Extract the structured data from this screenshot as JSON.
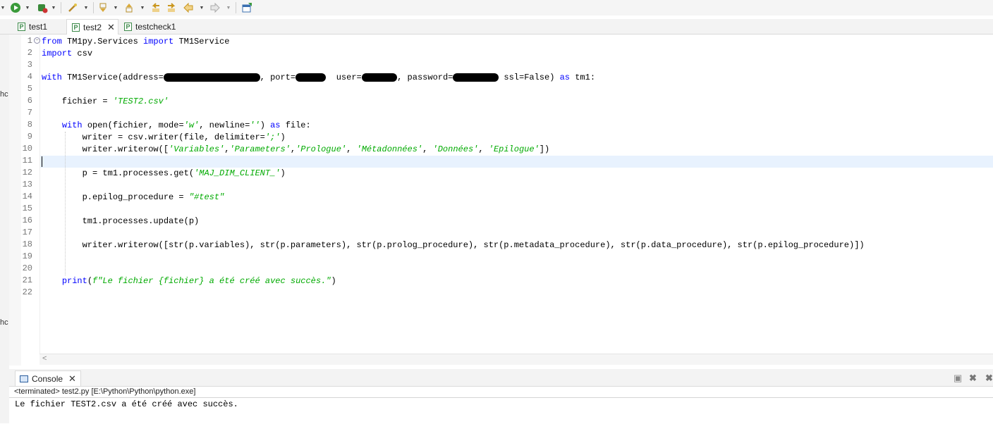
{
  "editor_tabs": [
    {
      "label": "test1"
    },
    {
      "label": "test2",
      "active": true,
      "closable": true
    },
    {
      "label": "testcheck1"
    }
  ],
  "left_panel_fragments": [
    "hc",
    "hc"
  ],
  "code_lines": [
    [
      {
        "t": "from",
        "c": "kw"
      },
      {
        "t": " TM1py.Services "
      },
      {
        "t": "import",
        "c": "kw"
      },
      {
        "t": " TM1Service"
      }
    ],
    [
      {
        "t": "import",
        "c": "kw"
      },
      {
        "t": " csv"
      }
    ],
    [],
    [
      {
        "t": "with",
        "c": "kw"
      },
      {
        "t": " TM1Service(address="
      },
      {
        "t": "                   ",
        "redact": true
      },
      {
        "t": ", port="
      },
      {
        "t": "      ",
        "redact": true
      },
      {
        "t": "  user="
      },
      {
        "t": "       ",
        "redact": true
      },
      {
        "t": ", password="
      },
      {
        "t": "         ",
        "redact": true
      },
      {
        "t": " ssl=False) "
      },
      {
        "t": "as",
        "c": "kw"
      },
      {
        "t": " tm1:"
      }
    ],
    [],
    [
      {
        "t": "    fichier = "
      },
      {
        "t": "'TEST2.csv'",
        "c": "str"
      }
    ],
    [],
    [
      {
        "t": "    "
      },
      {
        "t": "with",
        "c": "kw"
      },
      {
        "t": " open(fichier, mode="
      },
      {
        "t": "'w'",
        "c": "str"
      },
      {
        "t": ", newline="
      },
      {
        "t": "''",
        "c": "str"
      },
      {
        "t": ") "
      },
      {
        "t": "as",
        "c": "kw"
      },
      {
        "t": " file:"
      }
    ],
    [
      {
        "t": "        writer = csv.writer(file, delimiter="
      },
      {
        "t": "';'",
        "c": "str"
      },
      {
        "t": ")"
      }
    ],
    [
      {
        "t": "        writer.writerow(["
      },
      {
        "t": "'Variables'",
        "c": "str"
      },
      {
        "t": ","
      },
      {
        "t": "'Parameters'",
        "c": "str"
      },
      {
        "t": ","
      },
      {
        "t": "'Prologue'",
        "c": "str"
      },
      {
        "t": ", "
      },
      {
        "t": "'Métadonnées'",
        "c": "str"
      },
      {
        "t": ", "
      },
      {
        "t": "'Données'",
        "c": "str"
      },
      {
        "t": ", "
      },
      {
        "t": "'Epilogue'",
        "c": "str"
      },
      {
        "t": "])"
      }
    ],
    [],
    [
      {
        "t": "        p = tm1.processes.get("
      },
      {
        "t": "'MAJ_DIM_CLIENT_'",
        "c": "str"
      },
      {
        "t": ")"
      }
    ],
    [],
    [
      {
        "t": "        p.epilog_procedure = "
      },
      {
        "t": "\"#test\"",
        "c": "str"
      }
    ],
    [],
    [
      {
        "t": "        tm1.processes.update(p)"
      }
    ],
    [],
    [
      {
        "t": "        writer.writerow([str(p.variables), str(p.parameters), str(p.prolog_procedure), str(p.metadata_procedure), str(p.data_procedure), str(p.epilog_procedure)])"
      }
    ],
    [],
    [],
    [
      {
        "t": "    "
      },
      {
        "t": "print",
        "c": "kw"
      },
      {
        "t": "("
      },
      {
        "t": "f\"Le fichier {fichier} a été créé avec succès.\"",
        "c": "str"
      },
      {
        "t": ")"
      }
    ],
    []
  ],
  "console": {
    "tab_label": "Console",
    "status": "<terminated> test2.py [E:\\Python\\Python\\python.exe]",
    "output": "Le fichier TEST2.csv a été créé avec succès."
  }
}
